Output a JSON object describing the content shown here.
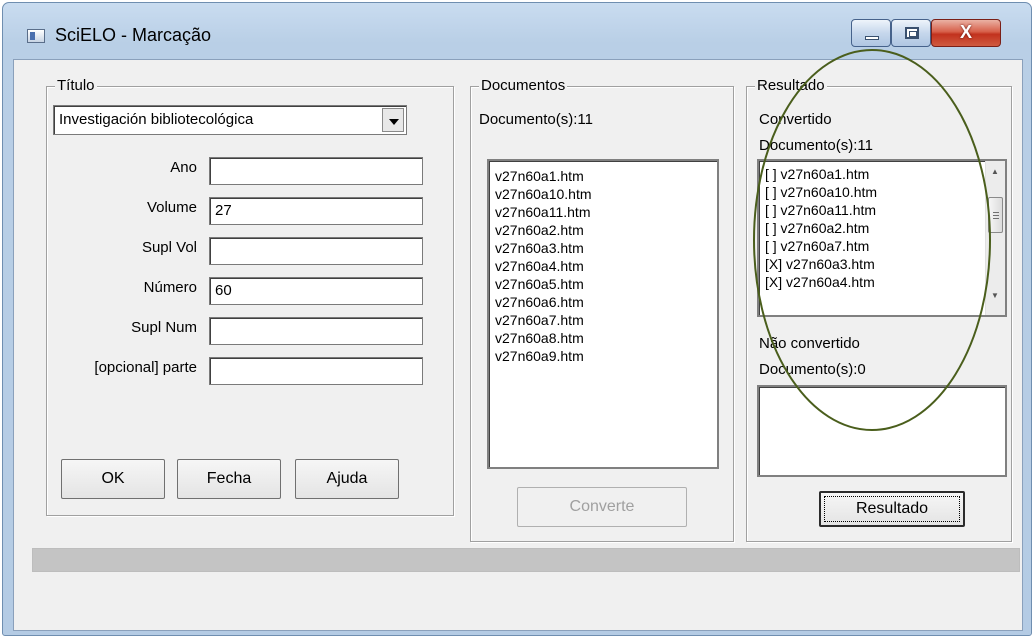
{
  "window": {
    "title": "SciELO - Marcação",
    "close_glyph": "X"
  },
  "titulo_group": {
    "legend": "Título",
    "journal_select": "Investigación bibliotecológica",
    "fields": {
      "ano_label": "Ano",
      "ano_value": "",
      "volume_label": "Volume",
      "volume_value": "27",
      "supl_vol_label": "Supl Vol",
      "supl_vol_value": "",
      "numero_label": "Número",
      "numero_value": "60",
      "supl_num_label": "Supl Num",
      "supl_num_value": "",
      "parte_label": "[opcional] parte",
      "parte_value": ""
    },
    "buttons": {
      "ok": "OK",
      "fecha": "Fecha",
      "ajuda": "Ajuda"
    }
  },
  "documentos_group": {
    "legend": "Documentos",
    "count": "Documento(s):11",
    "files": [
      "v27n60a1.htm",
      "v27n60a10.htm",
      "v27n60a11.htm",
      "v27n60a2.htm",
      "v27n60a3.htm",
      "v27n60a4.htm",
      "v27n60a5.htm",
      "v27n60a6.htm",
      "v27n60a7.htm",
      "v27n60a8.htm",
      "v27n60a9.htm"
    ],
    "converte_button": "Converte"
  },
  "resultado_group": {
    "legend": "Resultado",
    "convertido_label": "Convertido",
    "convertido_count": "Documento(s):11",
    "convertido_files": [
      "[ ] v27n60a1.htm",
      "[ ] v27n60a10.htm",
      "[ ] v27n60a11.htm",
      "[ ] v27n60a2.htm",
      "[ ] v27n60a7.htm",
      "[X] v27n60a3.htm",
      "[X] v27n60a4.htm"
    ],
    "nao_convertido_label": "Não convertido",
    "nao_convertido_count": "Documento(s):0",
    "resultado_button": "Resultado"
  },
  "colors": {
    "annotation_ellipse": "#4a5e1c",
    "dialog_bg": "#f0f0f0",
    "title_bar": "#b9cfe6",
    "close_button": "#c2321e",
    "progress_bar": "#c4c4c4"
  },
  "icons": {
    "app": "app-window-icon",
    "minimize": "minimize-icon",
    "maximize": "maximize-icon",
    "close": "close-icon",
    "dropdown": "chevron-down-icon",
    "scroll_up": "scroll-up-arrow-icon",
    "scroll_down": "scroll-down-arrow-icon"
  }
}
